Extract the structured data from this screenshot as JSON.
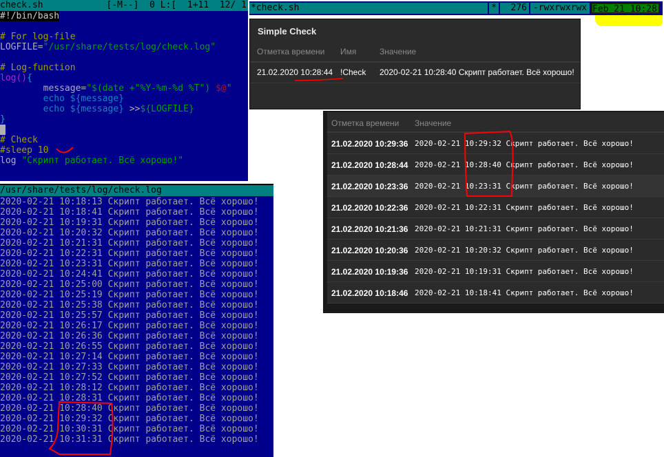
{
  "editor": {
    "filename": "check.sh",
    "status": "[-M--]  0 L:[  1+11  12/ 1",
    "lines": {
      "shebang": "#!/bin/bash",
      "c1": "# For log-file",
      "logfile_var": "LOGFILE=",
      "logfile_val": "\"/usr/share/tests/log/check.log\"",
      "c2": "# Log-function",
      "fn": "log()",
      "brace_open": "{",
      "msg_a": "        message=",
      "msg_b": "\"$(date +\"%Y-%m-%d %T\") ",
      "msg_c": "$@",
      "msg_d": "\"",
      "echo1": "        echo ${message}",
      "echo2a": "        echo ${message} ",
      "echo2b": ">>",
      "echo2c": "${LOGFILE}",
      "brace_close": "}",
      "c3": "# Check",
      "sleep": "#sleep 10",
      "call_a": "log ",
      "call_b": "\"Скрипт работает. Всё хорошо!\""
    }
  },
  "log": {
    "path": "/usr/share/tests/log/check.log",
    "date": "2020-02-21",
    "message": "Скрипт работает. Всё хорошо!",
    "times": [
      "10:18:13",
      "10:18:41",
      "10:19:31",
      "10:20:32",
      "10:21:31",
      "10:22:31",
      "10:23:31",
      "10:24:41",
      "10:25:00",
      "10:25:19",
      "10:25:38",
      "10:25:57",
      "10:26:17",
      "10:26:36",
      "10:26:55",
      "10:27:14",
      "10:27:33",
      "10:27:52",
      "10:28:12",
      "10:28:31",
      "10:28:40",
      "10:29:32",
      "10:30:31",
      "10:31:31"
    ]
  },
  "topbar": {
    "filename": "*check.sh",
    "flag": "*",
    "size": "276",
    "perms": "-rwxrwxrwx",
    "mtime": "Feb 21 10:28"
  },
  "simple_check": {
    "title": "Simple Check",
    "headers": [
      "Отметка времени",
      "Имя",
      "Значение"
    ],
    "row": {
      "timestamp": "21.02.2020 10:28:44",
      "name": "!Check",
      "value": "2020-02-21 10:28:40 Скрипт работает. Всё хорошо!"
    }
  },
  "history": {
    "headers": [
      "Отметка времени",
      "Значение"
    ],
    "rows": [
      {
        "timestamp": "21.02.2020 10:29:36",
        "value": "2020-02-21 10:29:32 Скрипт работает. Всё хорошо!"
      },
      {
        "timestamp": "21.02.2020 10:28:44",
        "value": "2020-02-21 10:28:40 Скрипт работает. Всё хорошо!"
      },
      {
        "timestamp": "21.02.2020 10:23:36",
        "value": "2020-02-21 10:23:31 Скрипт работает. Всё хорошо!"
      },
      {
        "timestamp": "21.02.2020 10:22:36",
        "value": "2020-02-21 10:22:31 Скрипт работает. Всё хорошо!"
      },
      {
        "timestamp": "21.02.2020 10:21:36",
        "value": "2020-02-21 10:21:31 Скрипт работает. Всё хорошо!"
      },
      {
        "timestamp": "21.02.2020 10:20:36",
        "value": "2020-02-21 10:20:32 Скрипт работает. Всё хорошо!"
      },
      {
        "timestamp": "21.02.2020 10:19:36",
        "value": "2020-02-21 10:19:31 Скрипт работает. Всё хорошо!"
      },
      {
        "timestamp": "21.02.2020 10:18:46",
        "value": "2020-02-21 10:18:41 Скрипт работает. Всё хорошо!"
      }
    ]
  },
  "colors": {
    "terminal_bg": "#00008b",
    "titlebar": "#008080",
    "panel_bg": "#2b2b2b",
    "annotation": "#ff0000",
    "highlight": "#ffff00"
  }
}
